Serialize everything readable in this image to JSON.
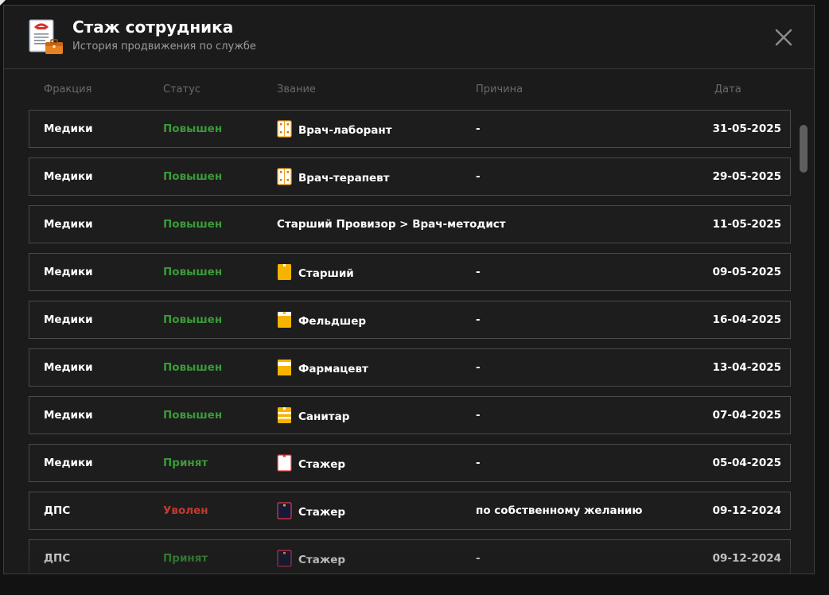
{
  "header": {
    "title": "Стаж сотрудника",
    "subtitle": "История продвижения по службе",
    "icon": "document-briefcase-icon",
    "close_icon": "close-icon"
  },
  "columns": {
    "faction": "Фракция",
    "status": "Статус",
    "rank": "Звание",
    "reason": "Причина",
    "date": "Дата"
  },
  "colors": {
    "promoted": "#3a9b38",
    "fired": "#c23b2f",
    "medic_badge_gold": "#f6b400",
    "police_badge_navy": "#141a38"
  },
  "rows": [
    {
      "faction": "Медики",
      "status": "Повышен",
      "status_type": "promoted",
      "badge": "doctor-coat-badge",
      "rank": "Врач-лаборант",
      "reason": "-",
      "date": "31-05-2025"
    },
    {
      "faction": "Медики",
      "status": "Повышен",
      "status_type": "promoted",
      "badge": "doctor-coat-badge",
      "rank": "Врач-терапевт",
      "reason": "-",
      "date": "29-05-2025"
    },
    {
      "faction": "Медики",
      "status": "Повышен",
      "status_type": "promoted",
      "badge": "",
      "rank": "Старший Провизор > Врач-методист",
      "reason": "",
      "date": "11-05-2025"
    },
    {
      "faction": "Медики",
      "status": "Повышен",
      "status_type": "promoted",
      "badge": "gold-full-badge",
      "rank": "Старший",
      "reason": "-",
      "date": "09-05-2025"
    },
    {
      "faction": "Медики",
      "status": "Повышен",
      "status_type": "promoted",
      "badge": "gold-white-top-badge",
      "rank": "Фельдшер",
      "reason": "-",
      "date": "16-04-2025"
    },
    {
      "faction": "Медики",
      "status": "Повышен",
      "status_type": "promoted",
      "badge": "gold-half-badge",
      "rank": "Фармацевт",
      "reason": "-",
      "date": "13-04-2025"
    },
    {
      "faction": "Медики",
      "status": "Повышен",
      "status_type": "promoted",
      "badge": "gold-stripes-badge",
      "rank": "Санитар",
      "reason": "-",
      "date": "07-04-2025"
    },
    {
      "faction": "Медики",
      "status": "Принят",
      "status_type": "promoted",
      "badge": "white-plain-badge",
      "rank": "Стажер",
      "reason": "-",
      "date": "05-04-2025"
    },
    {
      "faction": "ДПС",
      "status": "Уволен",
      "status_type": "fired",
      "badge": "navy-badge",
      "rank": "Стажер",
      "reason": "по собственному желанию",
      "date": "09-12-2024"
    },
    {
      "faction": "ДПС",
      "status": "Принят",
      "status_type": "promoted",
      "badge": "navy-badge",
      "rank": "Стажер",
      "reason": "-",
      "date": "09-12-2024"
    }
  ]
}
